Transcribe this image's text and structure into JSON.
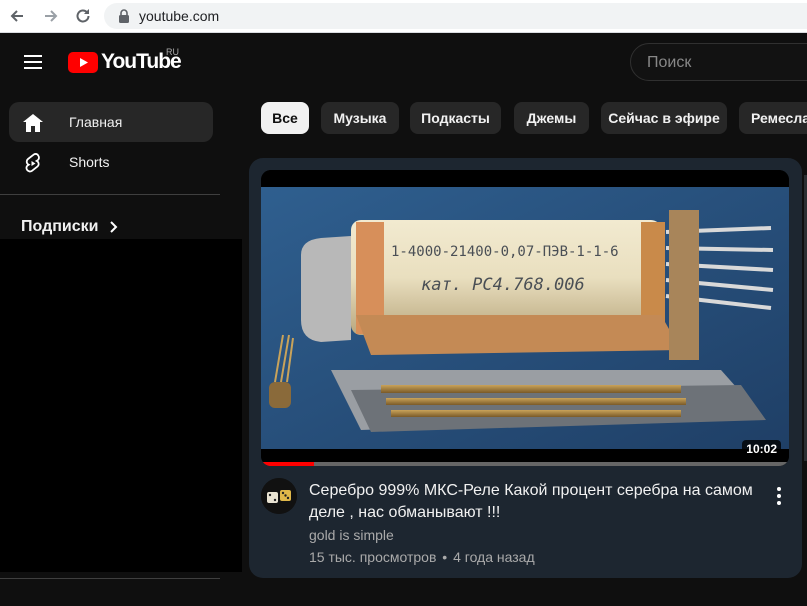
{
  "browser": {
    "url": "youtube.com"
  },
  "header": {
    "logo_text": "YouTube",
    "region": "RU",
    "search_placeholder": "Поиск"
  },
  "sidebar": {
    "items": [
      {
        "label": "Главная",
        "icon": "home-icon",
        "active": true
      },
      {
        "label": "Shorts",
        "icon": "shorts-icon",
        "active": false
      }
    ],
    "subscriptions_title": "Подписки"
  },
  "chips": [
    {
      "label": "Все",
      "active": true
    },
    {
      "label": "Музыка",
      "active": false
    },
    {
      "label": "Подкасты",
      "active": false
    },
    {
      "label": "Джемы",
      "active": false
    },
    {
      "label": "Сейчас в эфире",
      "active": false
    },
    {
      "label": "Ремесла",
      "active": false
    }
  ],
  "video": {
    "title": "Серебро 999% МКС-Реле Какой процент серебра на самом деле , нас обманывают !!!",
    "channel": "gold is simple",
    "views": "15 тыс. просмотров",
    "age": "4 года назад",
    "separator": "•",
    "duration": "10:02",
    "watched_fraction": 0.1,
    "thumbnail_text_1": "1-4000-21400-0,07-ПЭВ-1-1-6",
    "thumbnail_text_2": "кат. РС4.768.006"
  },
  "colors": {
    "background": "#0f0f0f",
    "card": "#1d2630",
    "chip": "#272727",
    "chip_active": "#f1f1f1",
    "accent_red": "#ff0000"
  }
}
